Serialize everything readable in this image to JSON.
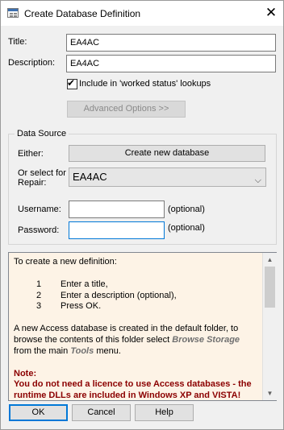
{
  "window": {
    "title": "Create Database Definition",
    "close_glyph": "✕",
    "icon": "database-icon"
  },
  "form": {
    "title_label": "Title:",
    "title_value": "EA4AC",
    "description_label": "Description:",
    "description_value": "EA4AC",
    "include_lookup_label": "Include in 'worked status' lookups",
    "include_lookup_checked": true,
    "check_glyph": "✔",
    "advanced_button": "Advanced Options >>"
  },
  "data_source": {
    "group_title": "Data Source",
    "either_label": "Either:",
    "create_button": "Create new database",
    "or_select_label_line1": "Or select for",
    "or_select_label_line2": "Repair:",
    "repair_selected": "EA4AC",
    "dropdown_glyph": "⌵",
    "username_label": "Username:",
    "username_value": "",
    "username_hint": "(optional)",
    "password_label": "Password:",
    "password_value": "",
    "password_hint": "(optional)"
  },
  "info": {
    "intro": "To create a new definition:",
    "steps": [
      {
        "num": "1",
        "text": "Enter a title,"
      },
      {
        "num": "2",
        "text": "Enter a description (optional),"
      },
      {
        "num": "3",
        "text": "Press OK."
      }
    ],
    "para_part1": "A new Access database is created in the default folder, to browse the contents of this folder select",
    "para_tag1": "Browse Storage",
    "para_part2": "from the main",
    "para_tag2": "Tools",
    "para_part3": "menu.",
    "note_title": "Note:",
    "note_text": "You do not need a licence to use Access databases - the runtime DLLs are included in Windows XP and VISTA!"
  },
  "buttons": {
    "ok": "OK",
    "cancel": "Cancel",
    "help": "Help"
  },
  "scrollbar": {
    "up_glyph": "▲",
    "down_glyph": "▼"
  },
  "colors": {
    "info_background": "#fdf3e6",
    "note_color": "#8b0000",
    "focus_border": "#0078d7"
  }
}
